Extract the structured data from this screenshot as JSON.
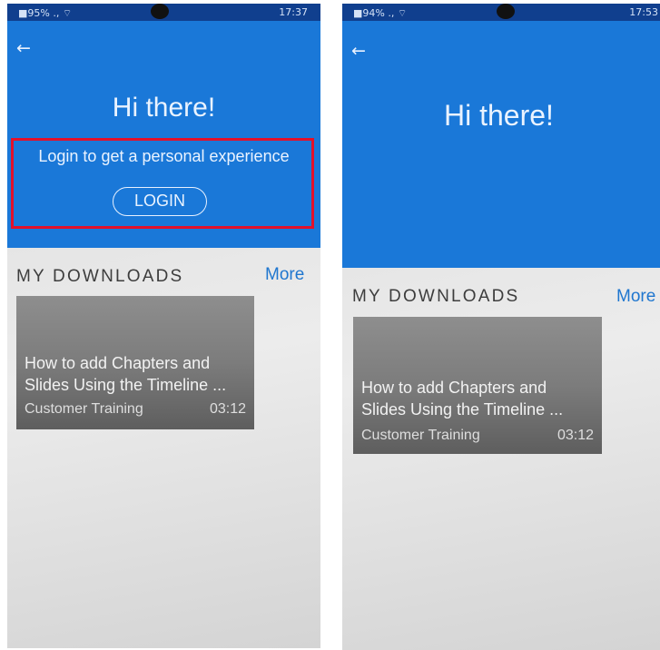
{
  "left_screen": {
    "status_bar": {
      "signal": "■95% ., ⌔",
      "time": "17:37"
    },
    "greeting": "Hi there!",
    "login_prompt": "Login to get a personal experience",
    "login_button": "LOGIN",
    "section_title": "MY DOWNLOADS",
    "more_link": "More",
    "card": {
      "title_line1": "How to add Chapters and",
      "title_line2": "Slides Using the Timeline ...",
      "author": "Customer Training",
      "duration": "03:12"
    }
  },
  "right_screen": {
    "status_bar": {
      "signal": "■94% ., ⌔",
      "time": "17:53"
    },
    "greeting": "Hi there!",
    "section_title": "MY DOWNLOADS",
    "more_link": "More",
    "card": {
      "title_line1": "How to add Chapters and",
      "title_line2": "Slides Using the Timeline ...",
      "author": "Customer Training",
      "duration": "03:12"
    }
  },
  "colors": {
    "header_blue": "#1a78d8",
    "status_blue": "#103f8e",
    "link_blue": "#1f76cf",
    "highlight_red": "#e3112a"
  },
  "icons": {
    "back": "arrow-left-icon"
  }
}
